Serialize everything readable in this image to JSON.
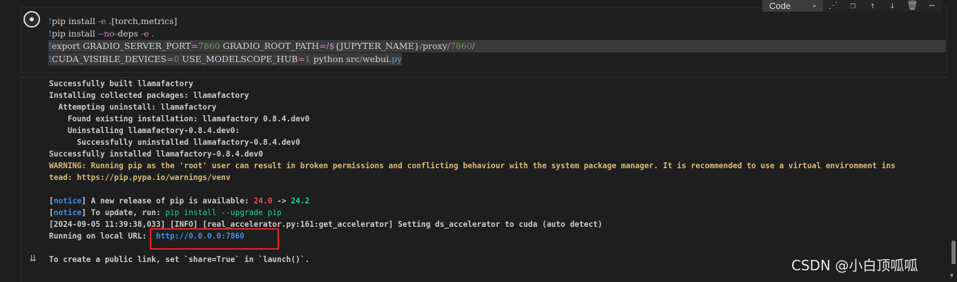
{
  "toolbar": {
    "cell_type": "Code",
    "icons": [
      "chevron-down-icon",
      "split-cell-icon",
      "copy-icon",
      "move-up-icon",
      "move-down-icon",
      "delete-icon",
      "more-icon"
    ]
  },
  "code_cell": {
    "lines": [
      {
        "bang": "!",
        "text": "pip install ",
        "op": "-e",
        ".[torch,metrics]": ""
      },
      {
        "text": "pip install"
      }
    ],
    "line1": {
      "bang": "!",
      "a": "pip install ",
      "b": "-e",
      " c": " .[torch,metrics]"
    },
    "l1_bang": "!",
    "l1_a": "pip install ",
    "l1_b": "-e",
    "l1_c": " .[torch,metrics]",
    "l2_bang": "!",
    "l2_a": "pip install ",
    "l2_b": "--",
    "l2_c": "no",
    "l2_d": "-",
    "l2_e": "deps ",
    "l2_f": "-e",
    "l2_g": " .",
    "l3_bang": "!",
    "l3_a": "export GRADIO_SERVER_PORT",
    "l3_b": "=",
    "l3_c": "7860",
    "l3_d": " GRADIO_ROOT_PATH",
    "l3_e": "=/",
    "l3_f": "$",
    "l3_g": "{JUPYTER_NAME}",
    "l3_h": "/",
    "l3_i": "proxy",
    "l3_j": "/",
    "l3_k": "7860",
    "l3_l": "/",
    "l4_bang": "!",
    "l4_a": "CUDA_VISIBLE_DEVICES",
    "l4_b": "=",
    "l4_c": "0",
    "l4_d": " USE_MODELSCOPE_HUB",
    "l4_e": "=",
    "l4_f": "1",
    "l4_g": " python src",
    "l4_h": "/",
    "l4_i": "webui.",
    "l4_j": "py"
  },
  "output": {
    "l1": "Successfully built llamafactory",
    "l2": "Installing collected packages: llamafactory",
    "l3": "  Attempting uninstall: llamafactory",
    "l4": "    Found existing installation: llamafactory 0.8.4.dev0",
    "l5": "    Uninstalling llamafactory-0.8.4.dev0:",
    "l6": "      Successfully uninstalled llamafactory-0.8.4.dev0",
    "l7": "Successfully installed llamafactory-0.8.4.dev0",
    "l8": "WARNING: Running pip as the 'root' user can result in broken permissions and conflicting behaviour with the system package manager. It is recommended to use a virtual environment ins",
    "l9": "tead: https://pip.pypa.io/warnings/venv",
    "n1_open": "[",
    "n1_tag": "notice",
    "n1_close": "]",
    "n1_text": " A new release of pip is available: ",
    "n1_old": "24.0",
    "n1_arrow": " -> ",
    "n1_new": "24.2",
    "n2_open": "[",
    "n2_tag": "notice",
    "n2_close": "]",
    "n2_text": " To update, run: ",
    "n2_cmd": "pip install --upgrade pip",
    "l12": "[2024-09-05 11:39:38,033] [INFO] [real_accelerator.py:161:get_accelerator] Setting ds_accelerator to cuda (auto detect)",
    "l13_label": "Running on local URL:  ",
    "l13_url": "http://0.0.0.0:7860",
    "l14": "To create a public link, set `share=True` in `launch()`."
  },
  "watermark": "CSDN @小白顶呱呱"
}
